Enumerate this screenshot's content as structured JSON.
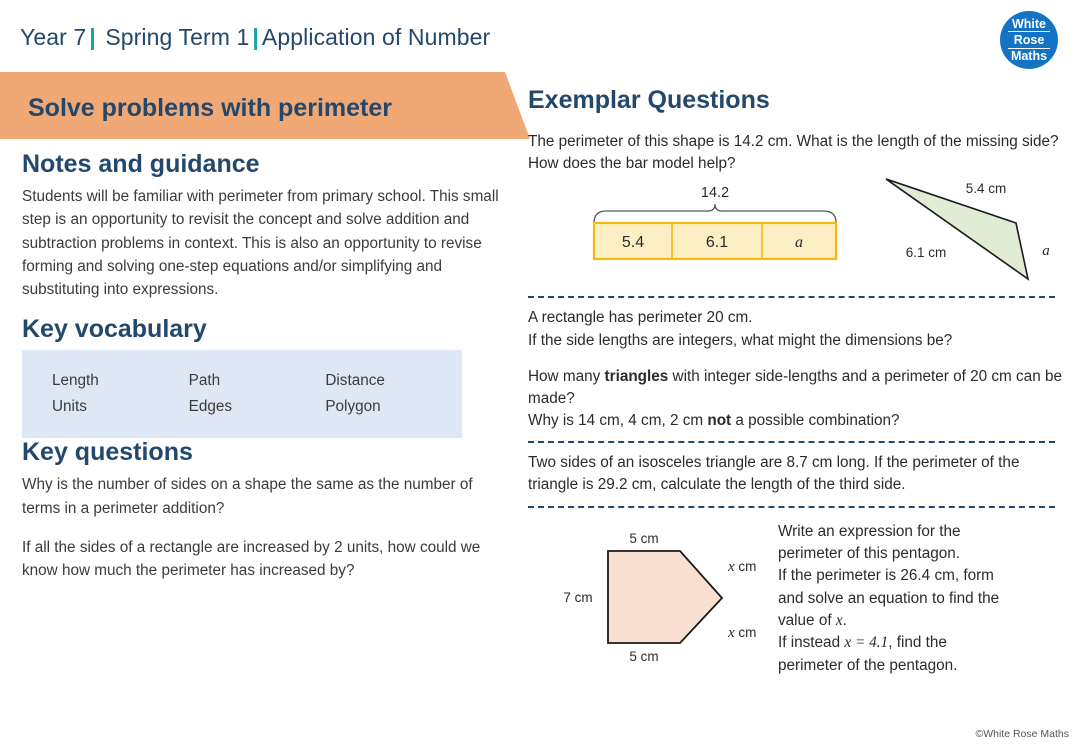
{
  "header": {
    "year": "Year 7",
    "term": "Spring Term  1",
    "topic": "Application of Number",
    "separator": "|"
  },
  "logo": {
    "line1": "White",
    "line2": "Rose",
    "line3": "Maths"
  },
  "banner": {
    "title": "Solve problems with perimeter",
    "color": "#f0a875"
  },
  "notes": {
    "heading": "Notes and guidance",
    "text": "Students will be familiar with perimeter from primary school.  This small step is an opportunity to revisit the concept and solve addition and subtraction problems in context.  This is also an opportunity to revise forming and solving one-step equations and/or simplifying and substituting into expressions."
  },
  "vocabulary": {
    "heading": "Key vocabulary",
    "background": "#dee8f4",
    "rows": [
      [
        "Length",
        "Path",
        "Distance"
      ],
      [
        "Units",
        "Edges",
        "Polygon"
      ]
    ]
  },
  "key_questions": {
    "heading": "Key questions",
    "q1": "Why is the number of sides on a shape the same as the number of terms in a perimeter addition?",
    "q2": "If all the sides of a rectangle are increased by 2 units, how could we know how much the perimeter has increased by?"
  },
  "exemplar": {
    "heading": "Exemplar Questions",
    "q1": "The perimeter of this shape is 14.2 cm. What is the length of the missing side? How does the bar model help?",
    "q2_line1": "A rectangle has perimeter 20 cm.",
    "q2_line2": "If the side lengths are integers, what might the dimensions be?",
    "q3_part1": "How many ",
    "q3_bold1": "triangles",
    "q3_part2": " with integer side-lengths and a perimeter of 20 cm can be made?",
    "q3_line2_part1": "Why is 14 cm, 4 cm, 2 cm ",
    "q3_bold2": "not",
    "q3_line2_part2": " a possible combination?",
    "q4": "Two sides of an isosceles triangle are 8.7 cm long. If the perimeter of the triangle is 29.2 cm, calculate the length of the third side.",
    "q5_line1": "Write an expression for the",
    "q5_line2": "perimeter of this pentagon.",
    "q5_line3": "If the perimeter is 26.4 cm, form",
    "q5_line4": "and solve an equation to find the",
    "q5_line5_pre": "value of ",
    "q5_line5_var": "x",
    "q5_line5_post": ".",
    "q5_line6_pre": "If instead ",
    "q5_line6_eq": "x = 4.1",
    "q5_line6_post": ", find the",
    "q5_line7": "perimeter of the pentagon."
  },
  "bar_model": {
    "total": "14.2",
    "cells": [
      "5.4",
      "6.1",
      "a"
    ],
    "fill": "#fdefc4",
    "stroke": "#f5b90a"
  },
  "triangle": {
    "label_top": "5.4 cm",
    "label_left": "6.1 cm",
    "label_right": "a",
    "fill": "#e0ecd4"
  },
  "pentagon": {
    "label_top": "5 cm",
    "label_left": "7 cm",
    "label_bottom": "5 cm",
    "label_upper_right": "x cm",
    "label_lower_right": "x cm",
    "fill": "#fae0d0"
  },
  "footer": {
    "copyright": "©White Rose Maths"
  }
}
